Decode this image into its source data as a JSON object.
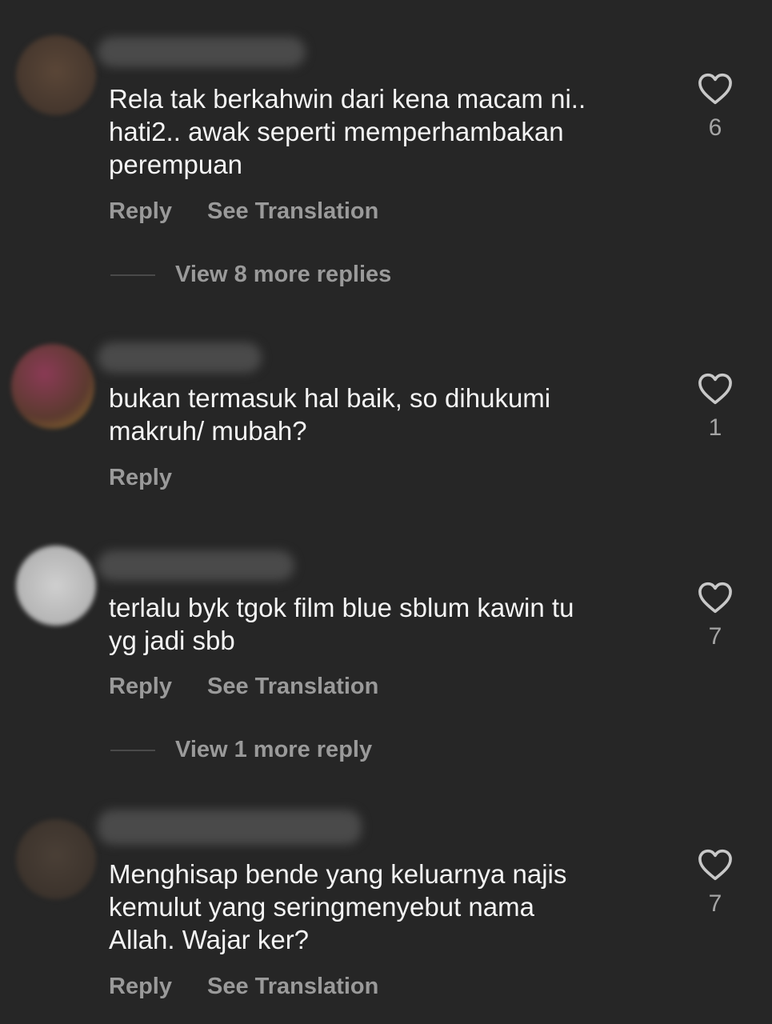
{
  "comments": [
    {
      "text": "Rela tak berkahwin dari kena macam ni..\nhati2.. awak seperti memperhambakan\nperempuan",
      "reply_label": "Reply",
      "translate_label": "See Translation",
      "view_more_label": "View 8 more replies",
      "like_count": "6",
      "avatar_color": "#4a3c31"
    },
    {
      "text": "bukan termasuk hal baik, so dihukumi\nmakruh/ mubah?",
      "reply_label": "Reply",
      "like_count": "1",
      "avatar_color": "#7a3a3f"
    },
    {
      "text": "terlalu byk tgok film blue sblum kawin tu\nyg jadi sbb",
      "reply_label": "Reply",
      "translate_label": "See Translation",
      "view_more_label": "View 1 more reply",
      "like_count": "7",
      "avatar_color": "#b8b8b8"
    },
    {
      "text": "Menghisap bende yang keluarnya najis\nkemulut yang seringmenyebut nama\nAllah. Wajar ker?",
      "reply_label": "Reply",
      "translate_label": "See Translation",
      "like_count": "7",
      "avatar_color": "#3f362f"
    }
  ],
  "icons": {
    "like": "heart-outline-icon"
  },
  "colors": {
    "background": "#262626",
    "text": "#f4f4f4",
    "muted": "#9a9a9a"
  }
}
